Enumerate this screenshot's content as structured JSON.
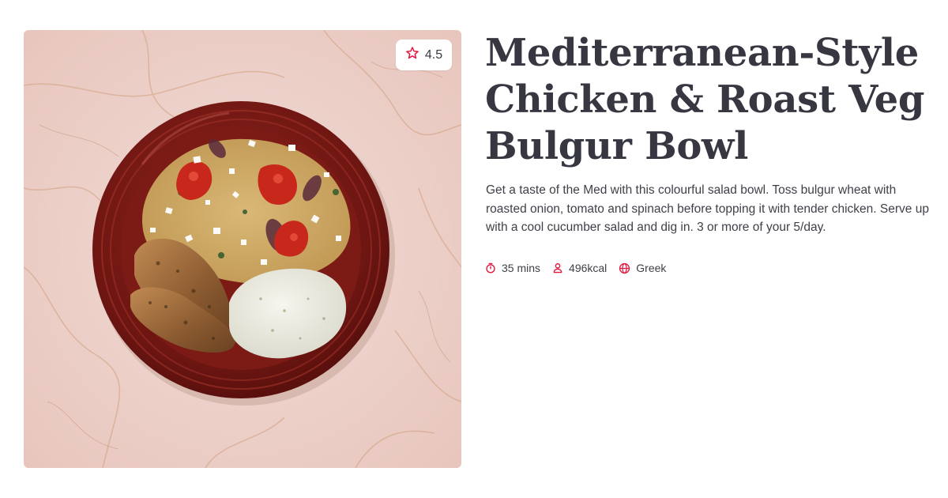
{
  "recipe": {
    "title": "Mediterranean-Style Chicken & Roast Veg Bulgur Bowl",
    "description": "Get a taste of the Med with this colourful salad bowl. Toss bulgur wheat with roasted onion, tomato and spinach before topping it with tender chicken. Serve up with a cool cucumber salad and dig in. 3 or more of your 5/day.",
    "rating": "4.5",
    "meta": {
      "time": "35 mins",
      "calories": "496kcal",
      "cuisine": "Greek"
    },
    "image": {
      "alt": "Chicken and roast veg bulgur bowl with tzatziki on a red plate"
    }
  },
  "icons": {
    "rating": "star-icon",
    "time": "stopwatch-icon",
    "calories": "person-icon",
    "cuisine": "globe-icon"
  },
  "colors": {
    "accent": "#e4173e",
    "title": "#373741",
    "text": "#3f3f48",
    "plate": "#7a1a16",
    "marble": "#efd5cf"
  }
}
